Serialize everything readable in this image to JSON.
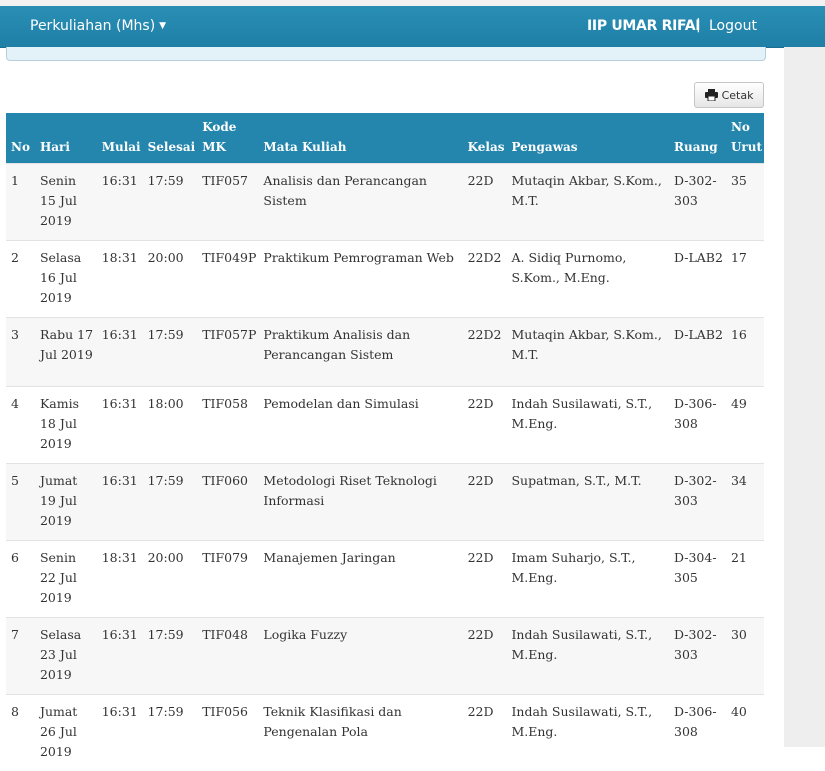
{
  "nav": {
    "brand": "Perkuliahan (Mhs)",
    "user": "IIP UMAR RIFAI",
    "separator": "|",
    "logout": "Logout"
  },
  "cetak_label": "Cetak",
  "table": {
    "headers": {
      "no": "No",
      "hari": "Hari",
      "mulai": "Mulai",
      "selesai": "Selesai",
      "kode_mk": "Kode MK",
      "mata_kuliah": "Mata Kuliah",
      "kelas": "Kelas",
      "pengawas": "Pengawas",
      "ruang": "Ruang",
      "no_urut": "No Urut"
    },
    "rows": [
      {
        "no": "1",
        "hari": "Senin 15 Jul 2019",
        "mulai": "16:31",
        "selesai": "17:59",
        "kode": "TIF057",
        "mk": "Analisis dan Perancangan Sistem",
        "kelas": "22D",
        "pengawas": "Mutaqin Akbar, S.Kom., M.T.",
        "ruang": "D-302-303",
        "urut": "35"
      },
      {
        "no": "2",
        "hari": "Selasa 16 Jul 2019",
        "mulai": "18:31",
        "selesai": "20:00",
        "kode": "TIF049P",
        "mk": "Praktikum Pemrograman Web",
        "kelas": "22D2",
        "pengawas": "A. Sidiq Purnomo, S.Kom., M.Eng.",
        "ruang": "D-LAB2",
        "urut": "17"
      },
      {
        "no": "3",
        "hari": "Rabu 17 Jul 2019",
        "mulai": "16:31",
        "selesai": "17:59",
        "kode": "TIF057P",
        "mk": "Praktikum Analisis dan Perancangan Sistem",
        "kelas": "22D2",
        "pengawas": "Mutaqin Akbar, S.Kom., M.T.",
        "ruang": "D-LAB2",
        "urut": "16"
      },
      {
        "no": "4",
        "hari": "Kamis 18 Jul 2019",
        "mulai": "16:31",
        "selesai": "18:00",
        "kode": "TIF058",
        "mk": "Pemodelan dan Simulasi",
        "kelas": "22D",
        "pengawas": "Indah Susilawati, S.T., M.Eng.",
        "ruang": "D-306-308",
        "urut": "49"
      },
      {
        "no": "5",
        "hari": "Jumat 19 Jul 2019",
        "mulai": "16:31",
        "selesai": "17:59",
        "kode": "TIF060",
        "mk": "Metodologi Riset Teknologi Informasi",
        "kelas": "22D",
        "pengawas": "Supatman, S.T., M.T.",
        "ruang": "D-302-303",
        "urut": "34"
      },
      {
        "no": "6",
        "hari": "Senin 22 Jul 2019",
        "mulai": "18:31",
        "selesai": "20:00",
        "kode": "TIF079",
        "mk": "Manajemen Jaringan",
        "kelas": "22D",
        "pengawas": "Imam Suharjo, S.T., M.Eng.",
        "ruang": "D-304-305",
        "urut": "21"
      },
      {
        "no": "7",
        "hari": "Selasa 23 Jul 2019",
        "mulai": "16:31",
        "selesai": "17:59",
        "kode": "TIF048",
        "mk": "Logika Fuzzy",
        "kelas": "22D",
        "pengawas": "Indah Susilawati, S.T., M.Eng.",
        "ruang": "D-302-303",
        "urut": "30"
      },
      {
        "no": "8",
        "hari": "Jumat 26 Jul 2019",
        "mulai": "16:31",
        "selesai": "17:59",
        "kode": "TIF056",
        "mk": "Teknik Klasifikasi dan Pengenalan Pola",
        "kelas": "22D",
        "pengawas": "Indah Susilawati, S.T., M.Eng.",
        "ruang": "D-306-308",
        "urut": "40"
      }
    ]
  }
}
